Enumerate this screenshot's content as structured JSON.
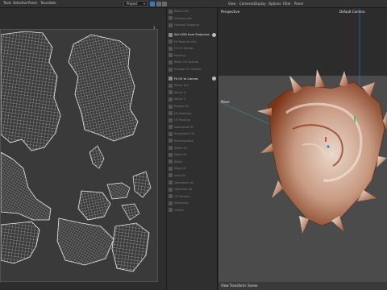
{
  "menubar": {
    "items": [
      "Tools",
      "Selection",
      "Panel",
      "Tessellate"
    ],
    "project_select": "Project"
  },
  "uv_editor": {
    "corner_label": "1"
  },
  "commands": [
    {
      "label": "Relax UVs",
      "active": false
    },
    {
      "label": "Unwrap UVs",
      "active": false
    },
    {
      "label": "Optimal Mapping",
      "active": false
    },
    {
      "label": "Set UVW from Projection",
      "active": true,
      "gear": true
    },
    {
      "label": "Fit Mesh to UVs",
      "active": false
    },
    {
      "label": "Fit UV Islands",
      "active": false
    },
    {
      "label": "Packing",
      "active": false
    },
    {
      "label": "Relax UV Islands",
      "active": false
    },
    {
      "label": "Realign UV Islands",
      "active": false
    },
    {
      "label": "Fit UV to Canvas",
      "active": true,
      "gear": true
    },
    {
      "label": "Mirror U/V",
      "active": false
    },
    {
      "label": "Mirror U",
      "active": false
    },
    {
      "label": "Mirror V",
      "active": false
    },
    {
      "label": "Rotate UV",
      "active": false
    },
    {
      "label": "Fit Selection",
      "active": false
    },
    {
      "label": "UV Packing",
      "active": false
    },
    {
      "label": "Normalize UV",
      "active": false
    },
    {
      "label": "Straighten UV",
      "active": false
    },
    {
      "label": "Rectangulate",
      "active": false
    },
    {
      "label": "Stitch UV",
      "active": false
    },
    {
      "label": "Weld UV",
      "active": false
    },
    {
      "label": "Relax",
      "active": false
    },
    {
      "label": "Align UV",
      "active": false
    },
    {
      "label": "Grid UV",
      "active": false
    },
    {
      "label": "Transform UV",
      "active": false
    },
    {
      "label": "Optimize UV",
      "active": false
    },
    {
      "label": "UV Terrace",
      "active": false
    },
    {
      "label": "Distribute",
      "active": false
    },
    {
      "label": "Unfold",
      "active": false
    }
  ],
  "viewport": {
    "menu": [
      "View",
      "Cameras",
      "Display",
      "Options",
      "Filter",
      "Panel"
    ],
    "view_name": "Perspective",
    "camera_name": "Default Camera",
    "axis_label": "Move",
    "status": "View Transform: Scene"
  },
  "colors": {
    "accent": "#2a7fd0",
    "shell_light": "#e6d2c4",
    "shell_rust": "#8b2e10"
  }
}
